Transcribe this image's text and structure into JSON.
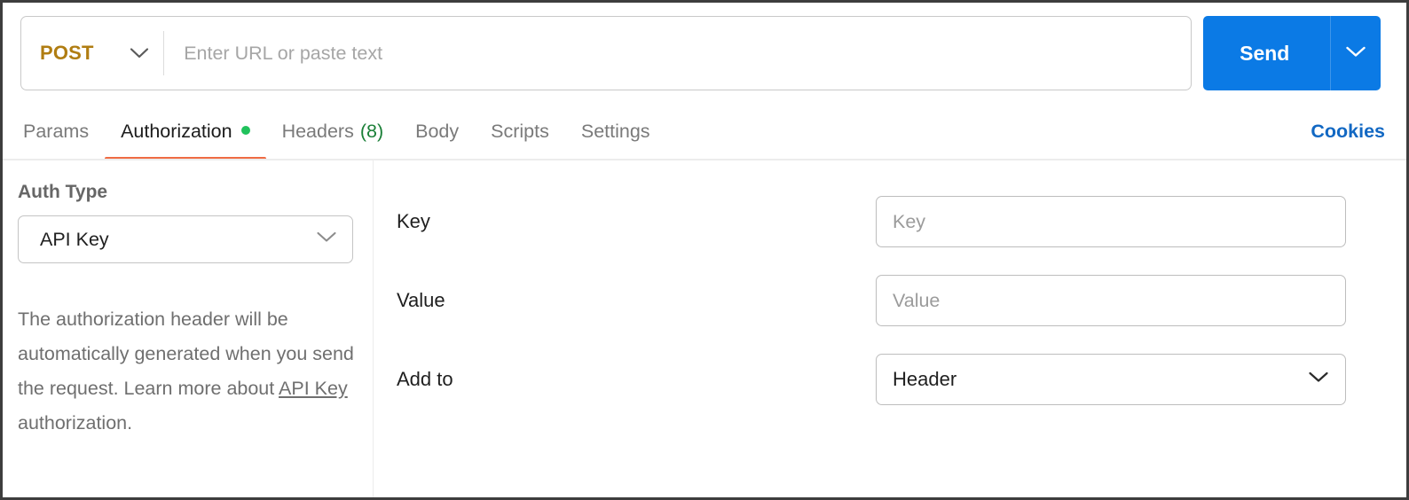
{
  "request_bar": {
    "method": "POST",
    "method_chevron_icon": "chevron-down-icon",
    "url_placeholder": "Enter URL or paste text",
    "url_value": "",
    "send_label": "Send",
    "send_caret_icon": "chevron-down-icon",
    "send_color": "#0b7ae5",
    "method_color": "#b07d12"
  },
  "tabs": {
    "items": [
      {
        "label": "Params",
        "active": false
      },
      {
        "label": "Authorization",
        "active": true,
        "dot": true
      },
      {
        "label": "Headers",
        "count": "(8)",
        "active": false
      },
      {
        "label": "Body",
        "active": false
      },
      {
        "label": "Scripts",
        "active": false
      },
      {
        "label": "Settings",
        "active": false
      }
    ],
    "cookies_label": "Cookies",
    "active_underline_color": "#ef6b43",
    "dot_color": "#21c25c",
    "count_color": "#1a7f37",
    "cookies_color": "#1268c3"
  },
  "auth_panel": {
    "type_label": "Auth Type",
    "type_value": "API Key",
    "type_chevron_icon": "chevron-down-icon",
    "description_part1": "The authorization header will be automatically generated when you send the request. Learn more about ",
    "description_link": "API Key",
    "description_part2": " authorization."
  },
  "auth_fields": {
    "key": {
      "label": "Key",
      "placeholder": "Key",
      "value": ""
    },
    "value": {
      "label": "Value",
      "placeholder": "Value",
      "value": ""
    },
    "add_to": {
      "label": "Add to",
      "selected": "Header",
      "chevron_icon": "chevron-down-icon"
    }
  }
}
